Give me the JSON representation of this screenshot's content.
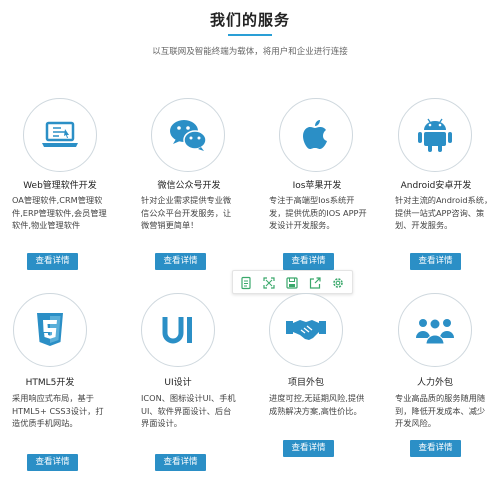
{
  "header": {
    "title": "我们的服务",
    "subtitle": "以互联网及智能终端为载体，将用户和企业进行连接"
  },
  "colors": {
    "accent": "#2a9fd6",
    "button": "#2b8fc6",
    "icon_ring": "#cfd8de"
  },
  "services": [
    {
      "icon": "laptop-icon",
      "title": "Web管理软件开发",
      "desc": "OA管理软件,CRM管理软件,ERP管理软件,会员管理软件,物业管理软件",
      "button": "查看详情"
    },
    {
      "icon": "wechat-icon",
      "title": "微信公众号开发",
      "desc": "针对企业需求提供专业微信公众平台开发服务，让微营销更简单！",
      "button": "查看详情"
    },
    {
      "icon": "apple-icon",
      "title": "Ios苹果开发",
      "desc": "专注于高端型Ios系统开发，提供优质的IOS APP开发设计开发服务。",
      "button": "查看详情"
    },
    {
      "icon": "android-icon",
      "title": "Android安卓开发",
      "desc": "针对主流的Android系统，提供一站式APP咨询、策划、开发服务。",
      "button": "查看详情"
    },
    {
      "icon": "html5-icon",
      "title": "HTML5开发",
      "desc": "采用响应式布局，基于HTML5+ CSS3设计，打造优质手机网站。",
      "button": "查看详情"
    },
    {
      "icon": "ui-icon",
      "title": "UI设计",
      "desc": "ICON、图标设计UI、手机UI、软件界面设计、后台界面设计。",
      "button": "查看详情"
    },
    {
      "icon": "handshake-icon",
      "title": "项目外包",
      "desc": "进度可控,无延期风险,提供成熟解决方案,高性价比。",
      "button": "查看详情"
    },
    {
      "icon": "team-icon",
      "title": "人力外包",
      "desc": "专业高品质的服务随用随到，降低开发成本、减少开发风险。",
      "button": "查看详情"
    }
  ],
  "toolbar": {
    "icons": [
      "document-icon",
      "expand-icon",
      "save-icon",
      "share-icon",
      "settings-icon"
    ]
  }
}
